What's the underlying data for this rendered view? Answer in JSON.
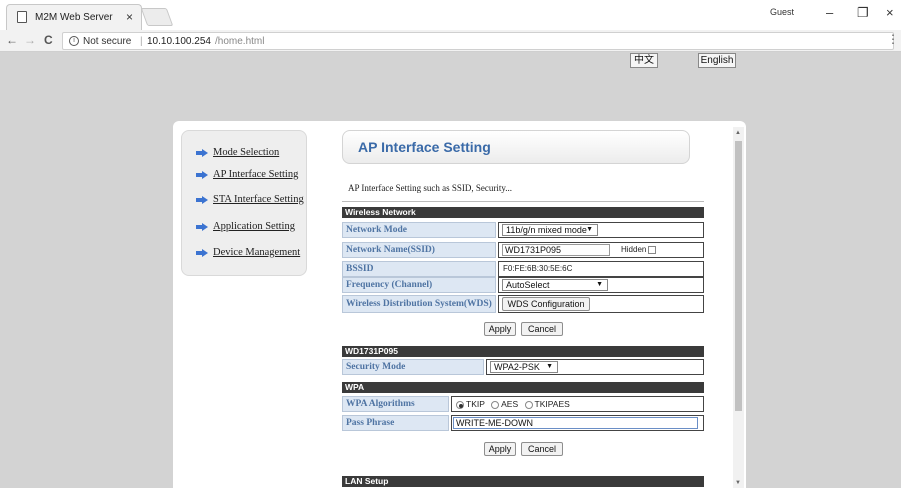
{
  "browser": {
    "tab_title": "M2M Web Server",
    "tab_close": "×",
    "user_badge": "Guest",
    "win_minimize": "–",
    "win_maximize": "❐",
    "win_close": "×",
    "nav_back": "←",
    "nav_forward": "→",
    "nav_reload": "C",
    "security_text": "Not secure",
    "url_host": "10.10.100.254",
    "url_path": "/home.html",
    "menu": "⋮"
  },
  "language": {
    "chinese": "中文",
    "english": "English"
  },
  "sidebar": {
    "items": [
      {
        "label": "Mode Selection"
      },
      {
        "label": "AP Interface Setting"
      },
      {
        "label": "STA Interface Setting"
      },
      {
        "label": "Application Setting"
      },
      {
        "label": "Device Management"
      }
    ],
    "arrow_color": "#3b73d1"
  },
  "main": {
    "title": "AP Interface Setting",
    "subtitle": "AP Interface Setting such as SSID, Security...",
    "wireless": {
      "header": "Wireless Network",
      "network_mode_label": "Network Mode",
      "network_mode_value": "11b/g/n mixed mode",
      "ssid_label": "Network Name(SSID)",
      "ssid_value": "WD1731P095",
      "hidden_label": "Hidden",
      "bssid_label": "BSSID",
      "bssid_value": "F0:FE:6B:30:5E:6C",
      "channel_label": "Frequency (Channel)",
      "channel_value": "AutoSelect",
      "wds_label": "Wireless Distribution System(WDS)",
      "wds_button": "WDS Configuration"
    },
    "apply_label": "Apply",
    "cancel_label": "Cancel",
    "security": {
      "header": "WD1731P095",
      "mode_label": "Security Mode",
      "mode_value": "WPA2-PSK"
    },
    "wpa": {
      "header": "WPA",
      "algorithms_label": "WPA Algorithms",
      "algorithms": [
        {
          "label": "TKIP",
          "checked": true
        },
        {
          "label": "AES",
          "checked": false
        },
        {
          "label": "TKIPAES",
          "checked": false
        }
      ],
      "passphrase_label": "Pass Phrase",
      "passphrase_value": "WRITE-ME-DOWN"
    },
    "lan": {
      "header": "LAN Setup"
    }
  }
}
